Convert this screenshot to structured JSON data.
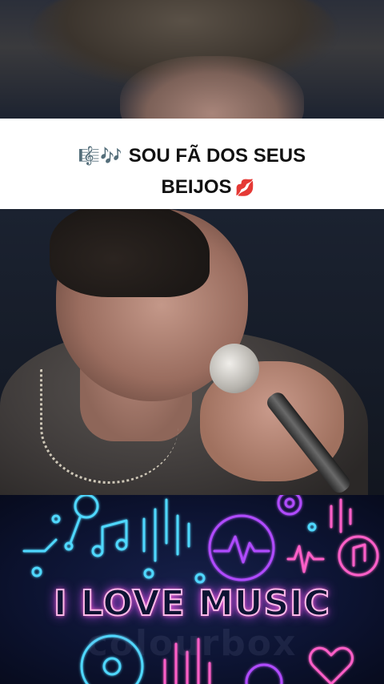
{
  "caption": {
    "line1_emoji": "🎼🎶",
    "line1_text": "SOU FÃ DOS SEUS",
    "line2_text": "BEIJOS",
    "line2_emoji": "💋"
  },
  "banner": {
    "headline": "I LOVE MUSIC",
    "watermark": "colourbox"
  },
  "colors": {
    "caption_bg": "#ffffff",
    "banner_bg": "#0d1433",
    "neon_pink": "#ff5fc8",
    "neon_cyan": "#4fd8ff",
    "neon_purple": "#b04cff"
  },
  "icons": [
    "microphone-icon",
    "music-note-icon",
    "sound-wave-icon",
    "pulse-icon",
    "gear-icon",
    "chat-music-icon",
    "vinyl-icon",
    "heart-icon",
    "equalizer-icon"
  ]
}
